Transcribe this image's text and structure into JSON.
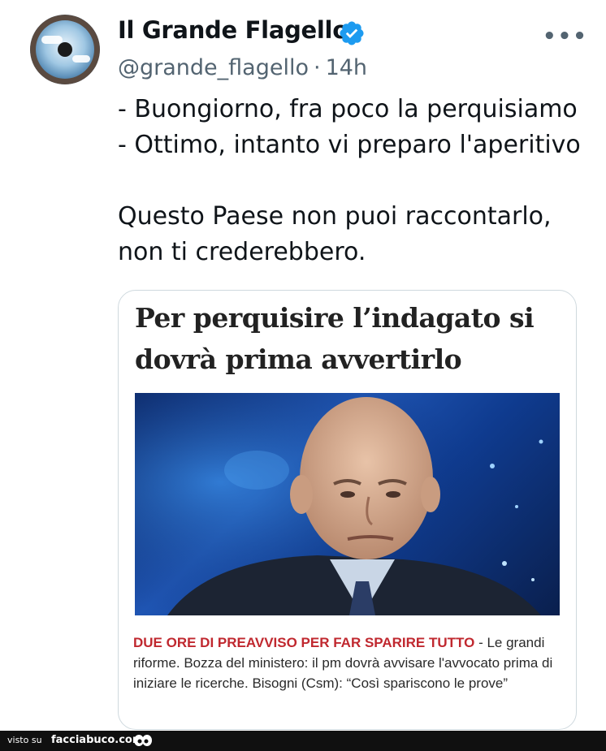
{
  "tweet": {
    "author_name": "Il Grande Flagello",
    "handle": "@grande_flagello",
    "separator": "·",
    "time": "14h",
    "more_label": "•••",
    "lines": [
      "- Buongiorno, fra poco la perquisiamo",
      "- Ottimo, intanto vi preparo l'aperitivo",
      "",
      "Questo Paese non puoi raccontarlo,",
      "non ti crederebbero."
    ]
  },
  "article": {
    "headline_line1": "Per perquisire l’indagato si",
    "headline_line2": "dovrà prima avvertirlo",
    "kicker": "DUE ORE DI PREAVVISO PER FAR SPARIRE TUTTO",
    "body": " - Le grandi riforme. Bozza del ministero: il pm dovrà avvisare l'avvocato prima di iniziare le ricerche. Bisogni (Csm): “Così spariscono le prove”"
  },
  "footer": {
    "prefix": "visto su",
    "site": "facciabuco.com"
  },
  "colors": {
    "verified_blue": "#1d9bf0",
    "kicker_red": "#c0282f",
    "secondary_text": "#536471"
  },
  "icons": {
    "verified": "verified-badge-icon",
    "more": "more-options-icon"
  }
}
